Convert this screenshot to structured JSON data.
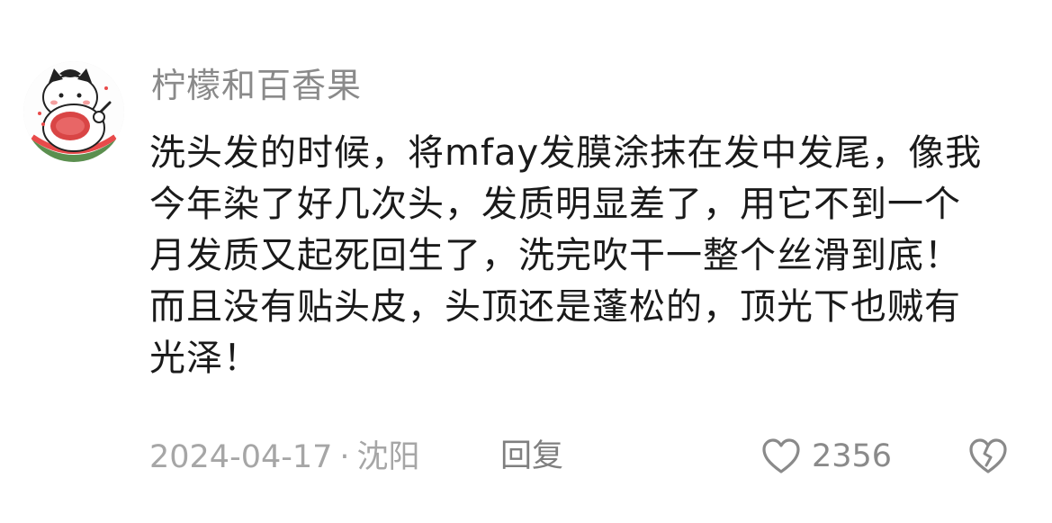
{
  "comment": {
    "username": "柠檬和百香果",
    "text_lines": [
      "洗头发的时候，将mfay发膜涂抹在发中发尾，像我",
      "今年染了好几次头，发质明显差了，用它不到一个",
      "月发质又起死回生了，洗完吹干一整个丝滑到底！",
      "而且没有贴头皮，头顶还是蓬松的，顶光下也贼有",
      "光泽！"
    ],
    "date": "2024-04-17",
    "separator": "·",
    "location": "沈阳",
    "reply_label": "回复",
    "like_count": "2356",
    "icons": {
      "avatar": "cartoon-cat-avatar",
      "like": "heart-outline-icon",
      "dislike": "broken-heart-icon"
    }
  },
  "colors": {
    "username": "#8a8a8a",
    "text": "#1a1a1a",
    "meta": "#a6a6a6",
    "reply": "#7f7f7f",
    "icon_stroke": "#8a8a8a"
  }
}
